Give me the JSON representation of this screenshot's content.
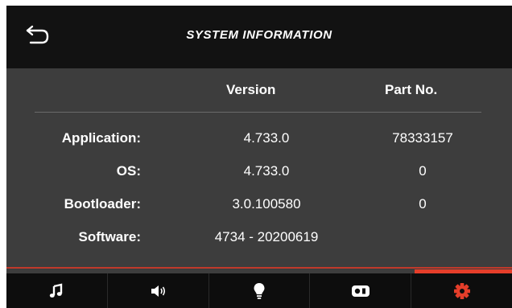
{
  "header": {
    "title": "SYSTEM INFORMATION"
  },
  "columns": {
    "version": "Version",
    "part_no": "Part No."
  },
  "rows": [
    {
      "label": "Application:",
      "version": "4.733.0",
      "part_no": "78333157"
    },
    {
      "label": "OS:",
      "version": "4.733.0",
      "part_no": "0"
    },
    {
      "label": "Bootloader:",
      "version": "3.0.100580",
      "part_no": "0"
    },
    {
      "label": "Software:",
      "version": "4734 - 20200619",
      "part_no": ""
    }
  ],
  "tabs": [
    {
      "icon": "music-note-icon"
    },
    {
      "icon": "speaker-icon"
    },
    {
      "icon": "light-bulb-icon"
    },
    {
      "icon": "media-source-icon"
    },
    {
      "icon": "gear-icon"
    }
  ],
  "active_tab": 4,
  "colors": {
    "accent": "#e53e2a",
    "header_bg": "#121212",
    "body_bg": "#3d3d3d",
    "footer_bg": "#0d0d0d"
  }
}
